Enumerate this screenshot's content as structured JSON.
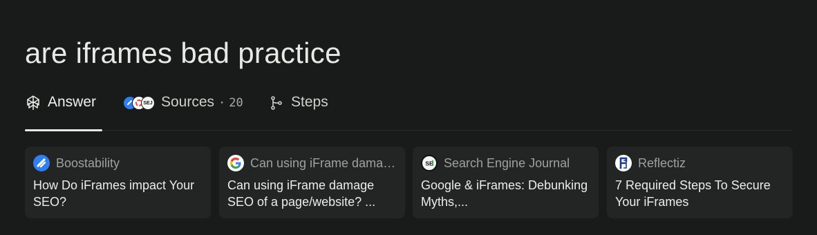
{
  "query": "are iframes bad practice",
  "tabs": {
    "answer": {
      "label": "Answer",
      "icon": "perplexity-logo-icon",
      "active": true
    },
    "sources": {
      "label": "Sources",
      "count_sep": "·",
      "count": "20",
      "icon": "source-favicons-stack"
    },
    "steps": {
      "label": "Steps",
      "icon": "steps-branch-icon"
    }
  },
  "sources": [
    {
      "site": "Boostability",
      "title": "How Do iFrames impact Your SEO?",
      "favicon": "boostability-favicon",
      "color": "#2f7ff0"
    },
    {
      "site": "Can using iFrame damage SEO of a page/website?",
      "title": "Can using iFrame damage SEO of a page/website? ...",
      "favicon": "google-favicon",
      "color": "#4285f4"
    },
    {
      "site": "Search Engine Journal",
      "title": "Google & iFrames: Debunking Myths,...",
      "favicon": "sej-favicon",
      "color": "#f4f4f4"
    },
    {
      "site": "Reflectiz",
      "title": "7 Required Steps To Secure Your iFrames",
      "favicon": "reflectiz-favicon",
      "color": "#1b3a8c"
    }
  ],
  "colors": {
    "background": "#191a1a",
    "card": "#232424",
    "text": "#e8e8e6",
    "muted": "#a0a19e"
  }
}
